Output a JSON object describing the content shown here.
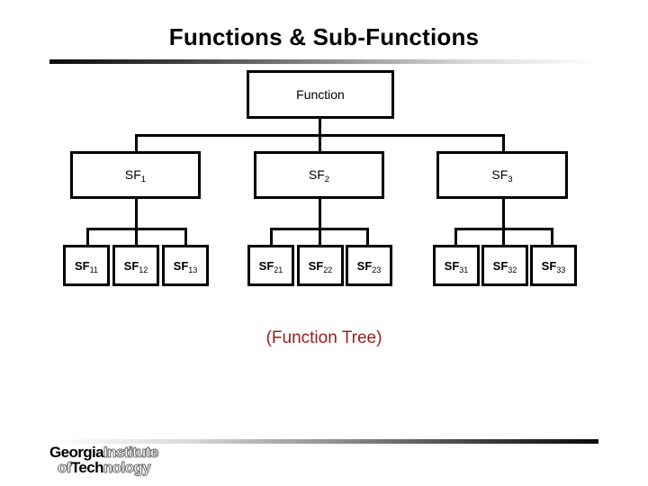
{
  "slide": {
    "title": "Functions & Sub-Functions",
    "caption": "(Function Tree)",
    "background_color": "#FFFFFF",
    "caption_color": "#9E1B1B",
    "line_color": "#000000"
  },
  "tree": {
    "root": {
      "label": "Function",
      "base": "Function",
      "sub": ""
    },
    "level1": [
      {
        "base": "SF",
        "sub": "1",
        "label": "SF1"
      },
      {
        "base": "SF",
        "sub": "2",
        "label": "SF2"
      },
      {
        "base": "SF",
        "sub": "3",
        "label": "SF3"
      }
    ],
    "level2": [
      {
        "base": "SF",
        "sub": "11",
        "label": "SF11"
      },
      {
        "base": "SF",
        "sub": "12",
        "label": "SF12"
      },
      {
        "base": "SF",
        "sub": "13",
        "label": "SF13"
      },
      {
        "base": "SF",
        "sub": "21",
        "label": "SF21"
      },
      {
        "base": "SF",
        "sub": "22",
        "label": "SF22"
      },
      {
        "base": "SF",
        "sub": "23",
        "label": "SF23"
      },
      {
        "base": "SF",
        "sub": "31",
        "label": "SF31"
      },
      {
        "base": "SF",
        "sub": "32",
        "label": "SF32"
      },
      {
        "base": "SF",
        "sub": "33",
        "label": "SF33"
      }
    ]
  },
  "logo": {
    "line1_solid": "Georgia",
    "line1_outline": "Institute",
    "line2_outline_prefix": "of",
    "line2_solid": "Tech",
    "line2_outline_suffix": "nology"
  },
  "decoration": {
    "rule_top_gradient": "dark-to-light",
    "rule_bottom_gradient": "light-to-dark"
  }
}
